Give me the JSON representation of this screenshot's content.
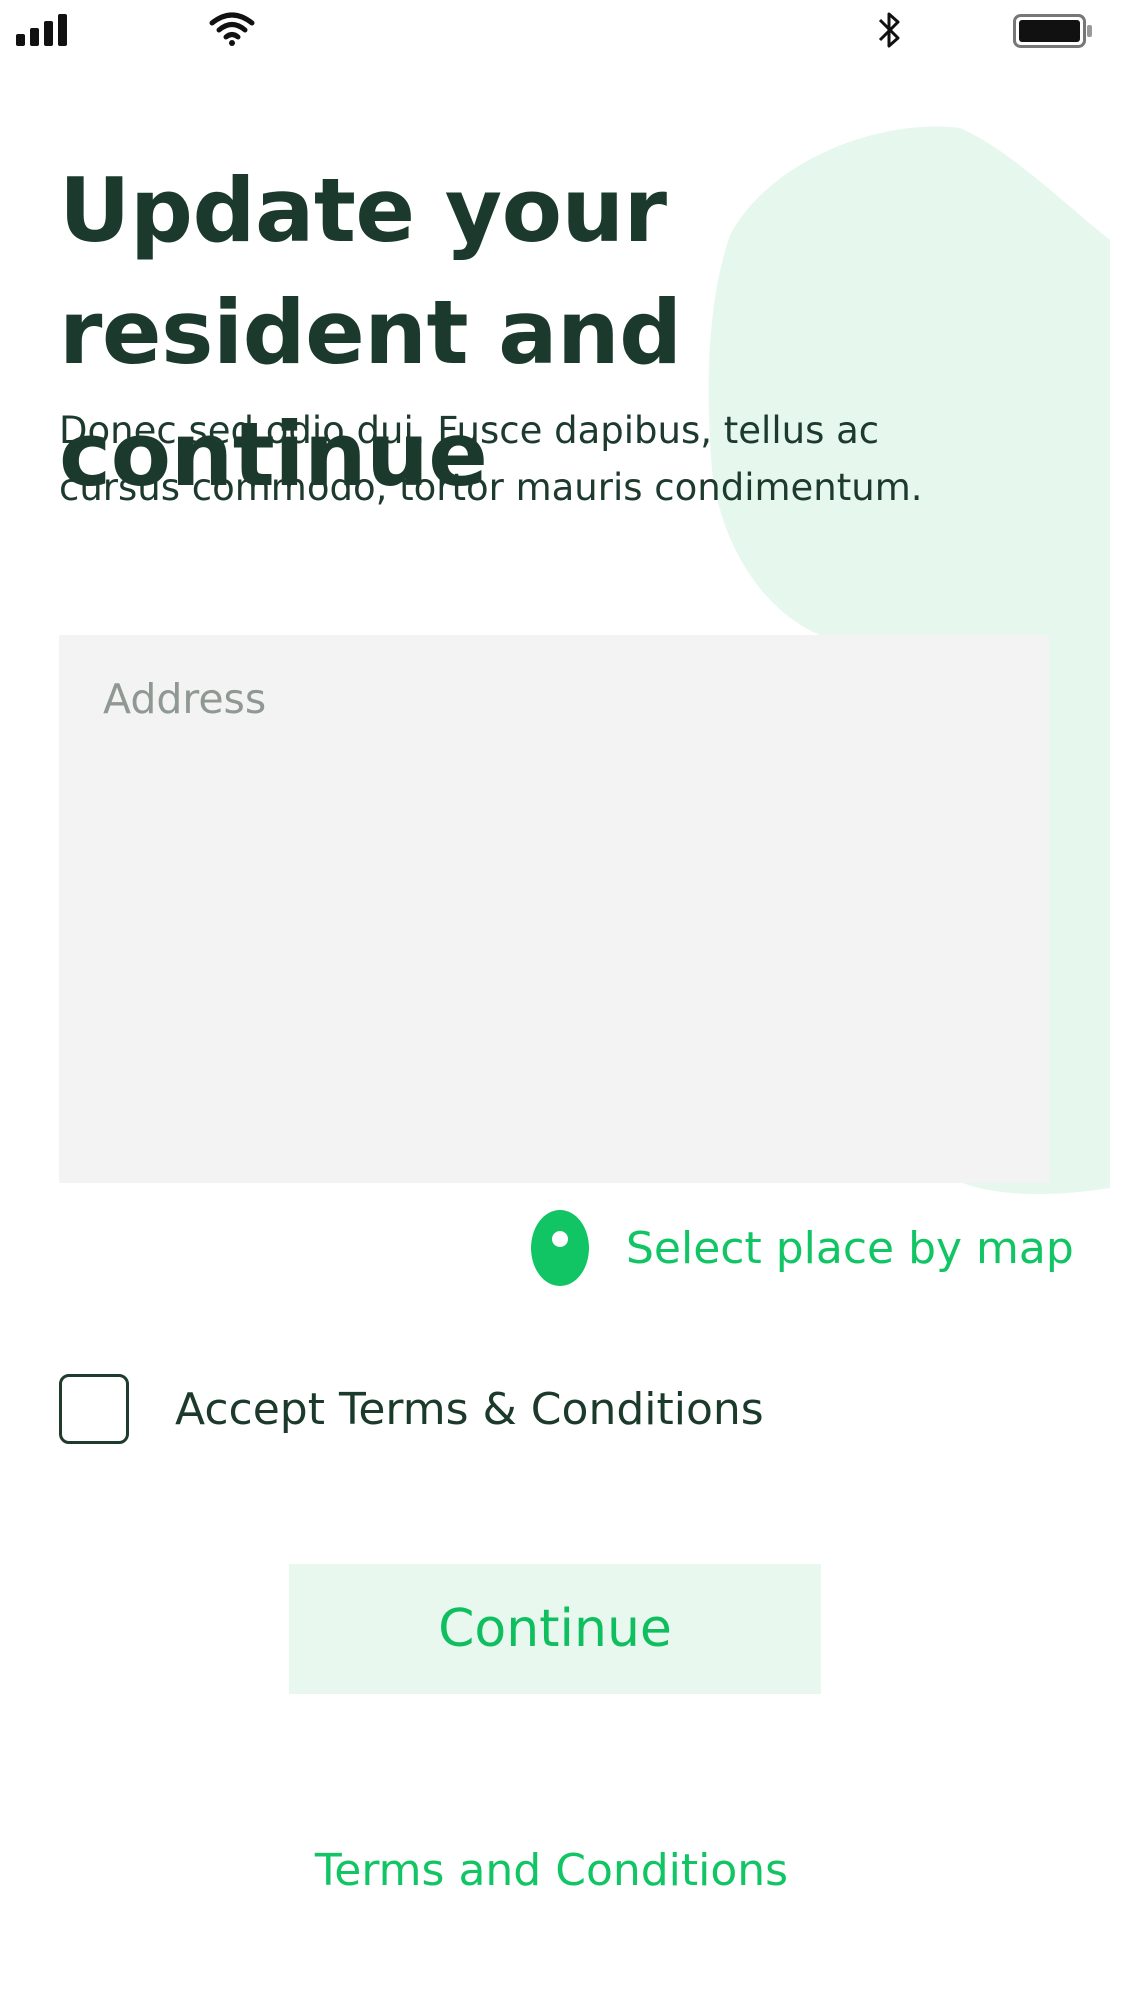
{
  "status_bar": {
    "icons": [
      "signal-icon",
      "wifi-icon",
      "bluetooth-icon",
      "battery-icon"
    ]
  },
  "header": {
    "title": "Update your resident and continue",
    "subtitle": "Donec sed odio dui. Fusce dapibus, tellus ac cursus commodo, tortor mauris condimentum."
  },
  "form": {
    "address": {
      "placeholder": "Address",
      "value": ""
    },
    "map_link": {
      "label": "Select place by map",
      "icon": "map-pin-icon"
    },
    "terms_checkbox": {
      "label": "Accept Terms & Conditions",
      "checked": false
    },
    "continue_label": "Continue"
  },
  "footer": {
    "terms_link": "Terms and Conditions"
  },
  "colors": {
    "text_dark": "#1b3a2d",
    "accent_green": "#11c564",
    "button_bg": "#e9f8ef",
    "blob_bg": "#e6f8ee",
    "input_bg": "#f3f3f3",
    "placeholder": "#8f9892"
  }
}
